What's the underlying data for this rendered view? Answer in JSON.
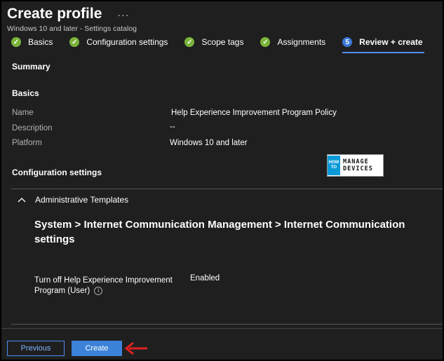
{
  "header": {
    "title": "Create profile",
    "more_label": "···",
    "subtitle": "Windows 10 and later - Settings catalog"
  },
  "steps": [
    {
      "label": "Basics",
      "status": "complete"
    },
    {
      "label": "Configuration settings",
      "status": "complete"
    },
    {
      "label": "Scope tags",
      "status": "complete"
    },
    {
      "label": "Assignments",
      "status": "complete"
    },
    {
      "label": "Review + create",
      "status": "current",
      "number": "5"
    }
  ],
  "summary": {
    "heading": "Summary",
    "basics_heading": "Basics",
    "fields": [
      {
        "key": "Name",
        "value": "Help Experience Improvement Program Policy"
      },
      {
        "key": "Description",
        "value": "--"
      },
      {
        "key": "Platform",
        "value": "Windows 10 and later"
      }
    ],
    "config_heading": "Configuration settings"
  },
  "logo": {
    "small_top": "HOW",
    "small_bottom": "TO",
    "line1": "MANAGE",
    "line2": "DEVICES"
  },
  "config": {
    "group_label": "Administrative Templates",
    "category": "System > Internet Communication Management > Internet Communication settings",
    "setting_name": "Turn off Help Experience Improvement Program (User)",
    "setting_value": "Enabled"
  },
  "footer": {
    "previous_label": "Previous",
    "create_label": "Create"
  },
  "colors": {
    "background": "#1f1f1f",
    "complete_check": "#7ab33a",
    "accent": "#3b82d8",
    "annotation_arrow": "#e02020"
  }
}
